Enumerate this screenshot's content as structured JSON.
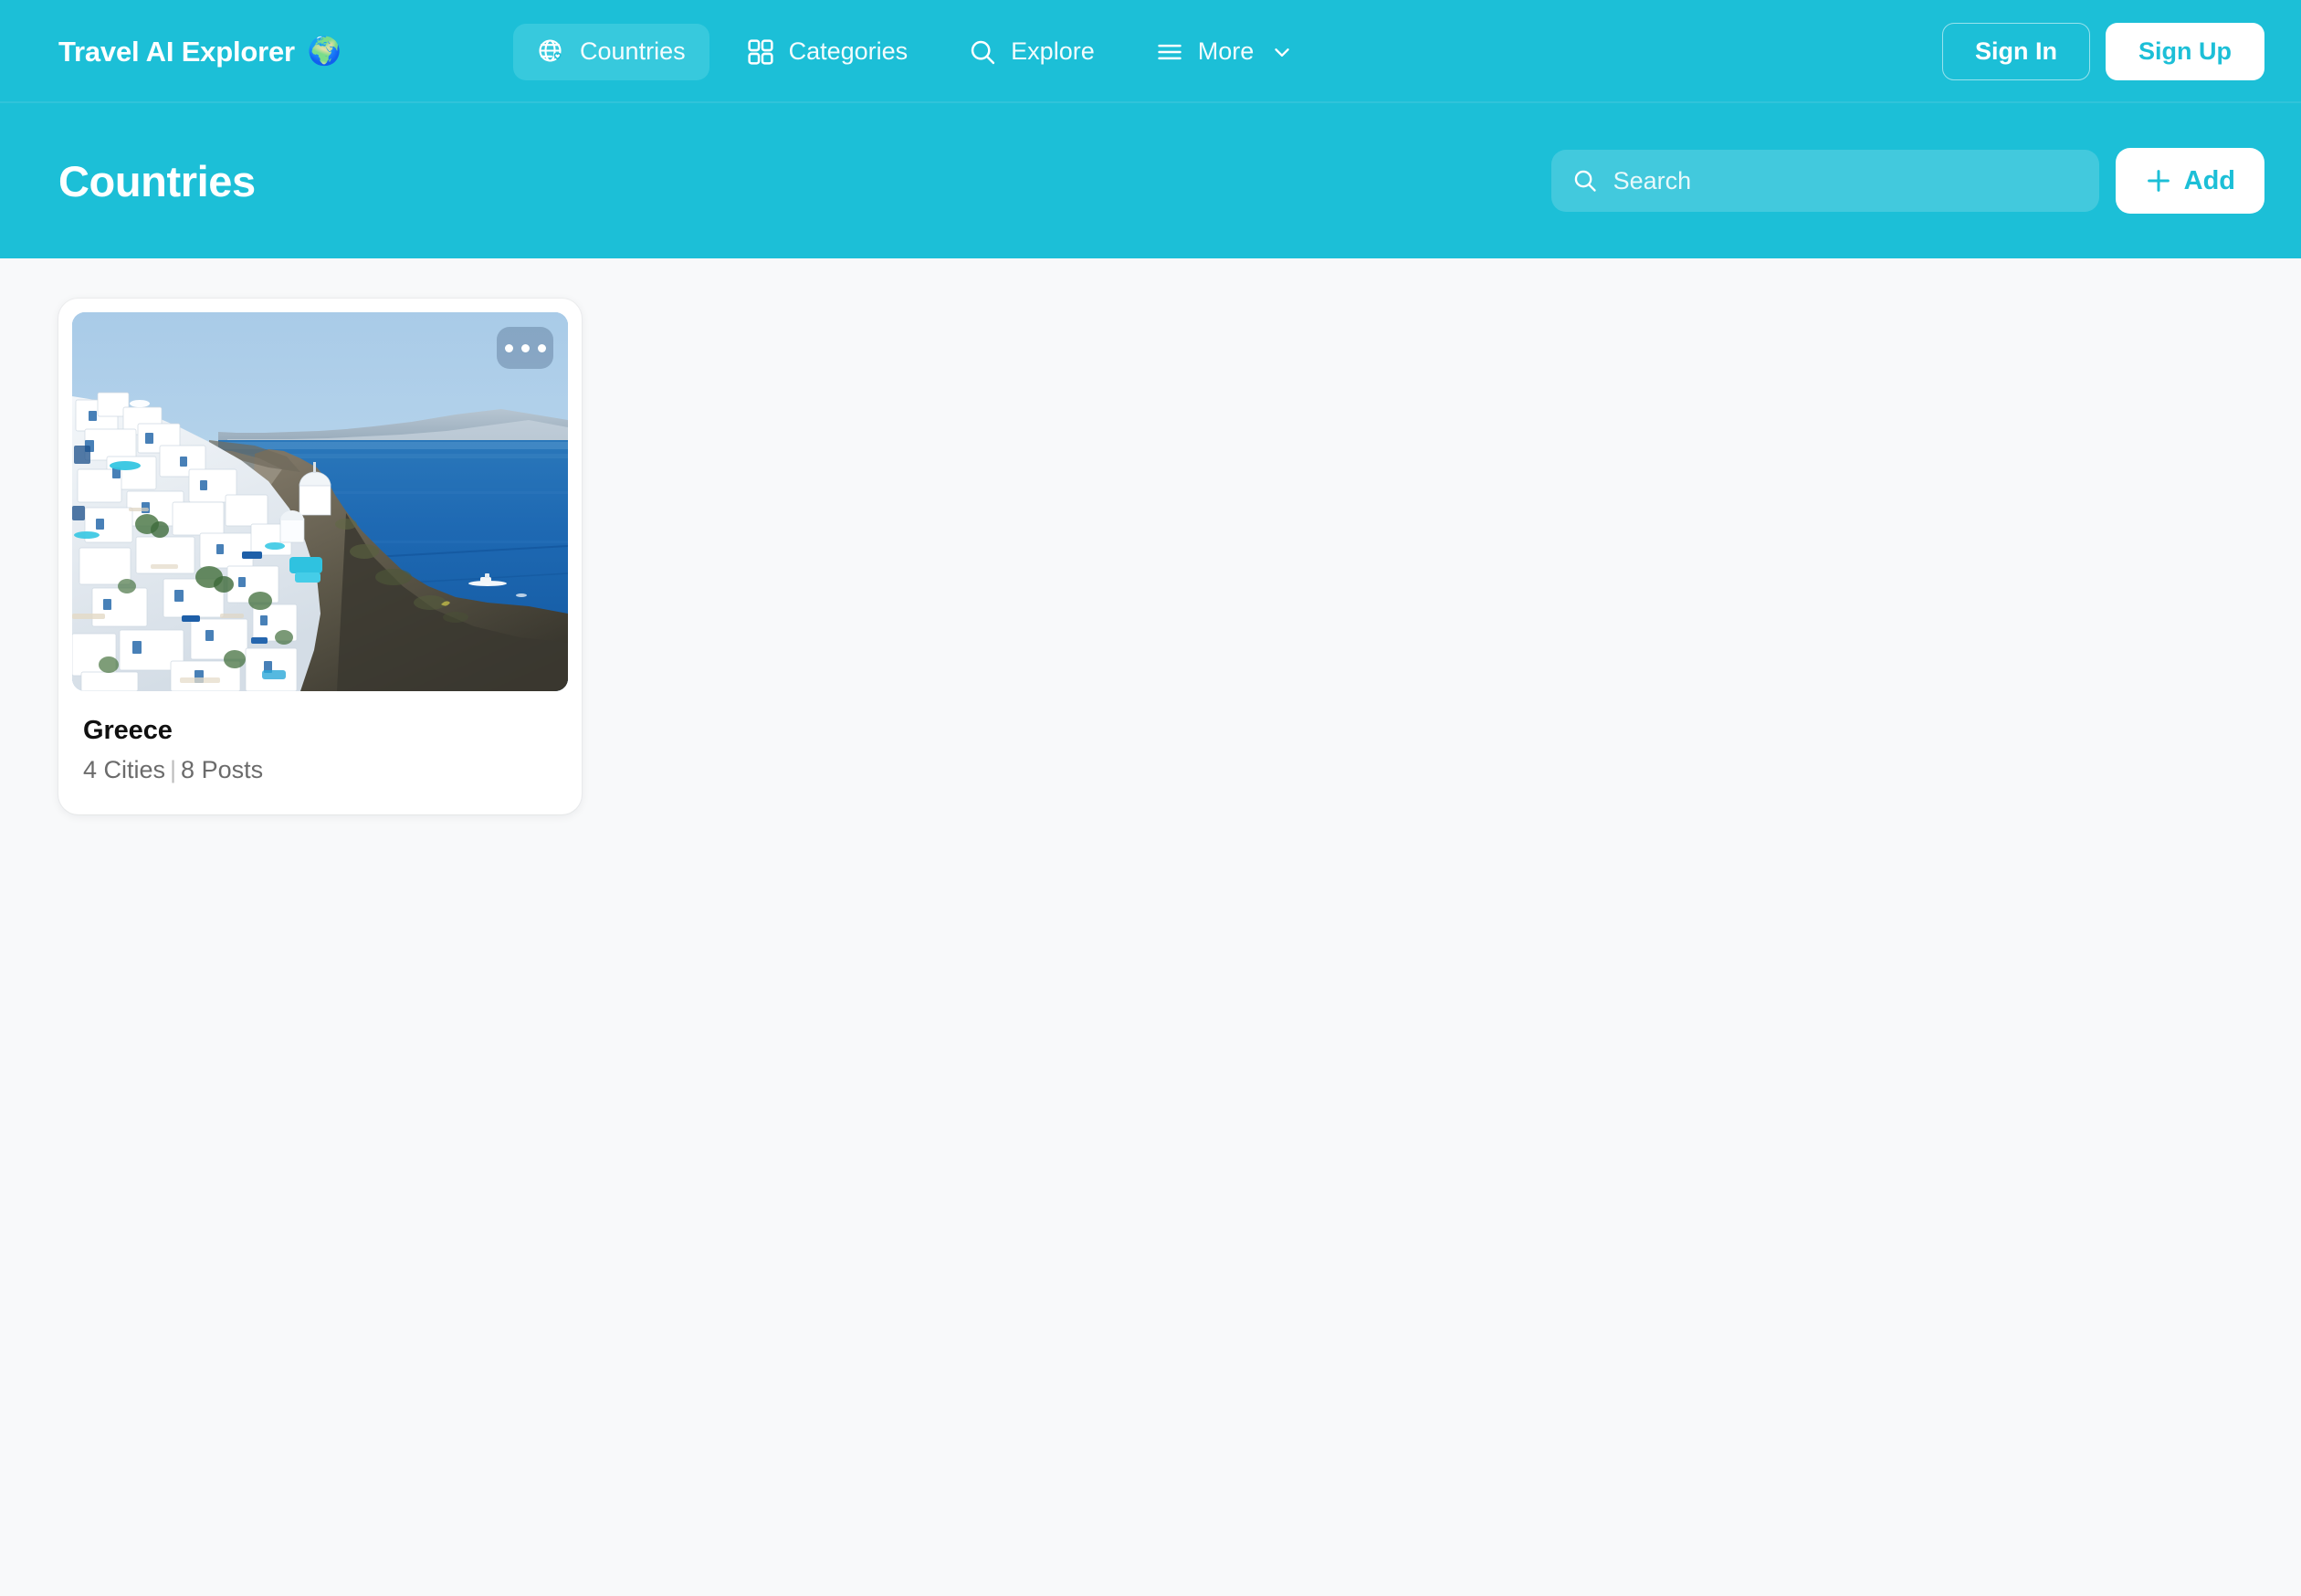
{
  "brand": {
    "name": "Travel AI Explorer",
    "globe_emoji": "🌍"
  },
  "nav": {
    "items": [
      {
        "label": "Countries",
        "icon": "globe-heart-icon",
        "active": true,
        "has_chevron": false
      },
      {
        "label": "Categories",
        "icon": "grid-icon",
        "active": false,
        "has_chevron": false
      },
      {
        "label": "Explore",
        "icon": "search-icon",
        "active": false,
        "has_chevron": false
      },
      {
        "label": "More",
        "icon": "hamburger-icon",
        "active": false,
        "has_chevron": true
      }
    ]
  },
  "auth": {
    "sign_in_label": "Sign In",
    "sign_up_label": "Sign Up"
  },
  "page_header": {
    "title": "Countries",
    "search": {
      "placeholder": "Search",
      "value": ""
    },
    "add_button_label": "Add"
  },
  "cards": [
    {
      "title": "Greece",
      "cities_count": 4,
      "posts_count": 8,
      "meta_cities": "4 Cities",
      "meta_separator": "|",
      "meta_posts": "8 Posts",
      "image_alt": "Whitewashed Santorini cliffside village overlooking the deep blue Aegean sea",
      "menu_label": "..."
    }
  ],
  "colors": {
    "brand_cyan": "#1cbfd7",
    "nav_active_pill": "#37c9dd",
    "page_background": "#f8f9fa",
    "card_surface": "#ffffff",
    "title_text": "#101010",
    "meta_text": "#6b6b6b",
    "accent_on_white": "#1cbfd7"
  }
}
